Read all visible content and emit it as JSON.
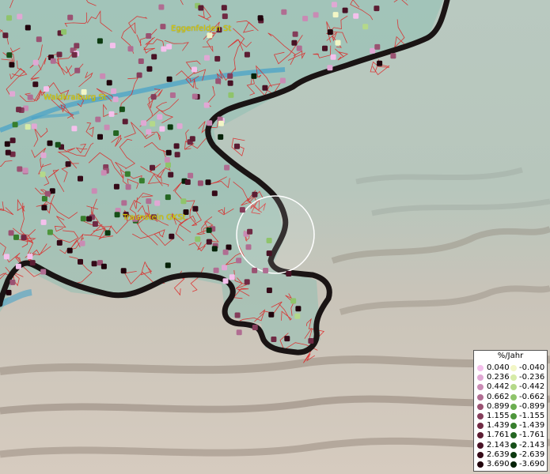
{
  "map": {
    "places": [
      {
        "name": "Eggenfelden St"
      },
      {
        "name": "Waldkraiburg St"
      },
      {
        "name": "Traunstein GKSt"
      }
    ]
  },
  "legend": {
    "title": "%/Jahr",
    "positive": [
      {
        "label": "0.040",
        "color": "#f4c0ec"
      },
      {
        "label": "0.236",
        "color": "#e0a8d4"
      },
      {
        "label": "0.442",
        "color": "#c98bb4"
      },
      {
        "label": "0.662",
        "color": "#b06d92"
      },
      {
        "label": "0.899",
        "color": "#9a5272"
      },
      {
        "label": "1.155",
        "color": "#843d5a"
      },
      {
        "label": "1.439",
        "color": "#702a44"
      },
      {
        "label": "1.761",
        "color": "#5c1d33"
      },
      {
        "label": "2.143",
        "color": "#481225"
      },
      {
        "label": "2.639",
        "color": "#350a18"
      },
      {
        "label": "3.690",
        "color": "#20040c"
      }
    ],
    "negative": [
      {
        "label": "-0.040",
        "color": "#f2f6c6"
      },
      {
        "label": "-0.236",
        "color": "#d6eba8"
      },
      {
        "label": "-0.442",
        "color": "#b4d98a"
      },
      {
        "label": "-0.662",
        "color": "#8fc46b"
      },
      {
        "label": "-0.899",
        "color": "#6bad50"
      },
      {
        "label": "-1.155",
        "color": "#4e963c"
      },
      {
        "label": "-1.439",
        "color": "#377e2d"
      },
      {
        "label": "-1.761",
        "color": "#246622"
      },
      {
        "label": "-2.143",
        "color": "#164f18"
      },
      {
        "label": "-2.639",
        "color": "#0c3a10"
      },
      {
        "label": "-3.690",
        "color": "#052208"
      }
    ]
  }
}
